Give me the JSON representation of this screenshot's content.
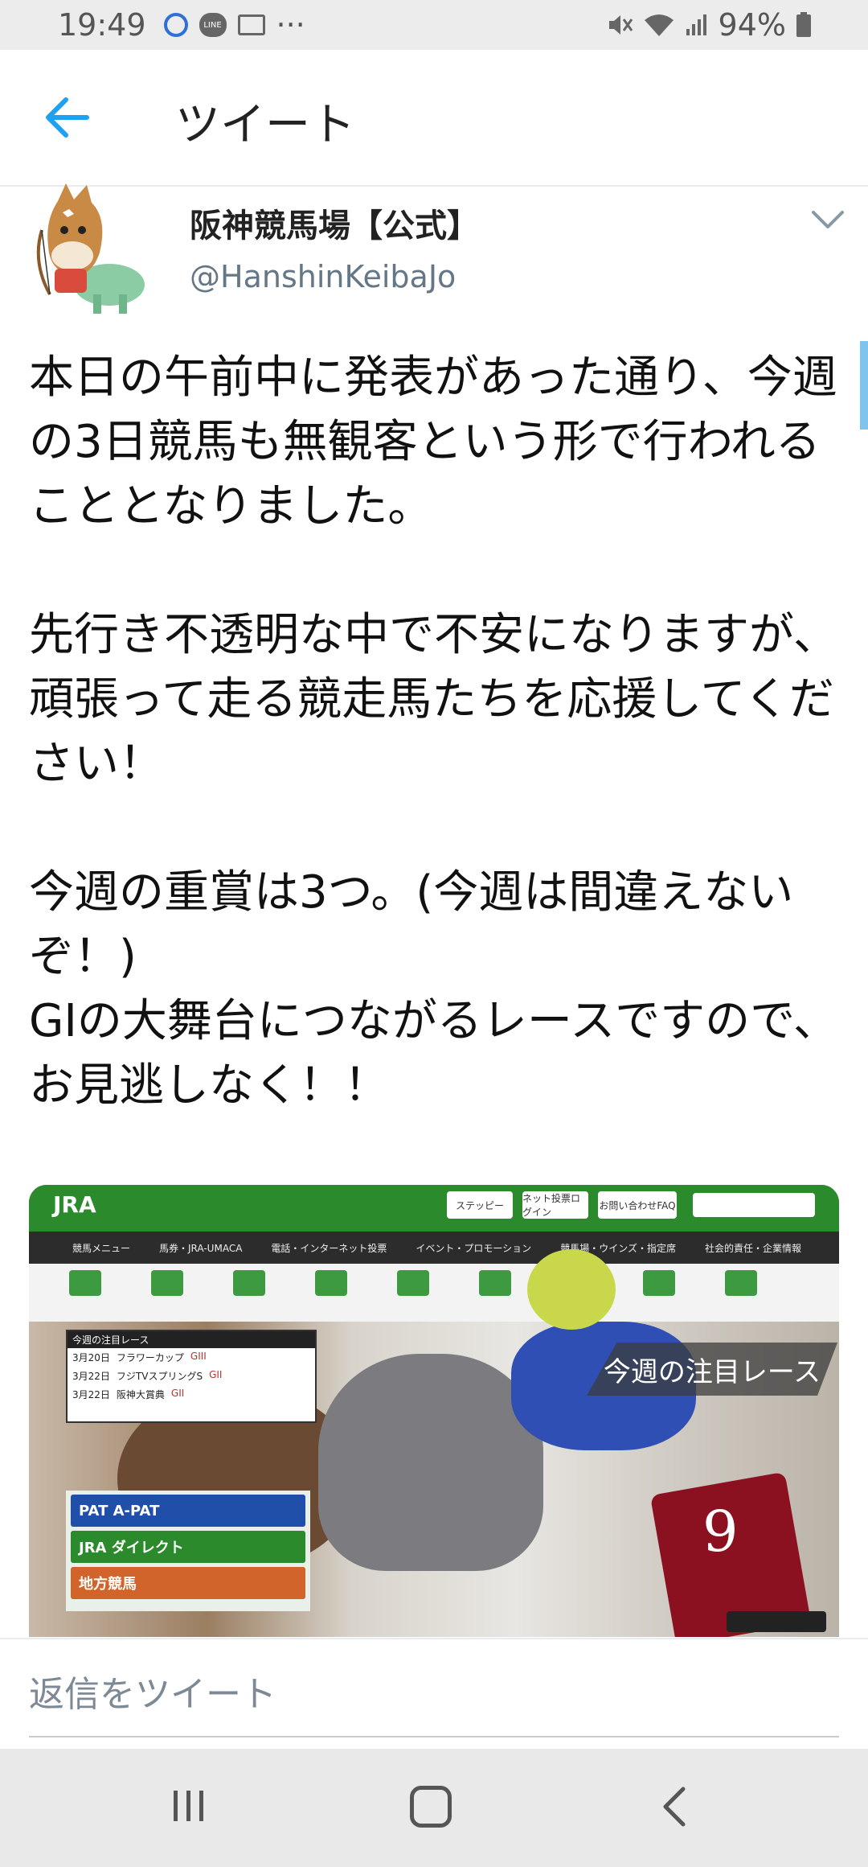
{
  "status_bar": {
    "time": "19:49",
    "battery": "94%",
    "more": "···",
    "line_label": "LINE"
  },
  "header": {
    "title": "ツイート"
  },
  "author": {
    "name": "阪神競馬場【公式】",
    "handle": "@HanshinKeibaJo"
  },
  "tweet": {
    "text": "本日の午前中に発表があった通り、今週の3日競馬も無観客という形で行われることとなりました。\n\n先行き不透明な中で不安になりますが、頑張って走る競走馬たちを応援してください！\n\n今週の重賞は3つ。(今週は間違えないぞ！)\nGIの大舞台につながるレースですので、お見逃しなく！！"
  },
  "media": {
    "logo": "JRA",
    "top_buttons": [
      "ステッピー",
      "ネット投票ログイン",
      "お問い合わせFAQ"
    ],
    "nav": [
      "競馬メニュー",
      "馬券・JRA-UMACA",
      "電話・インターネット投票",
      "イベント・プロモーション",
      "競馬場・ウインズ・指定席",
      "社会的責任・企業情報"
    ],
    "panel_title": "今週の注目レース",
    "races": [
      {
        "date": "3月20日",
        "name": "フラワーカップ",
        "grade": "GIII"
      },
      {
        "date": "3月22日",
        "name": "フジTVスプリングS",
        "grade": "GII"
      },
      {
        "date": "3月22日",
        "name": "阪神大賞典",
        "grade": "GII"
      }
    ],
    "banner": "今週の注目レース",
    "login_rows": [
      "PAT A-PAT",
      "JRA ダイレクト",
      "地方競馬"
    ],
    "saddle_number": "9"
  },
  "reply": {
    "placeholder": "返信をツイート"
  },
  "colors": {
    "accent": "#1da1f2",
    "jra_green": "#2a8a2c"
  }
}
